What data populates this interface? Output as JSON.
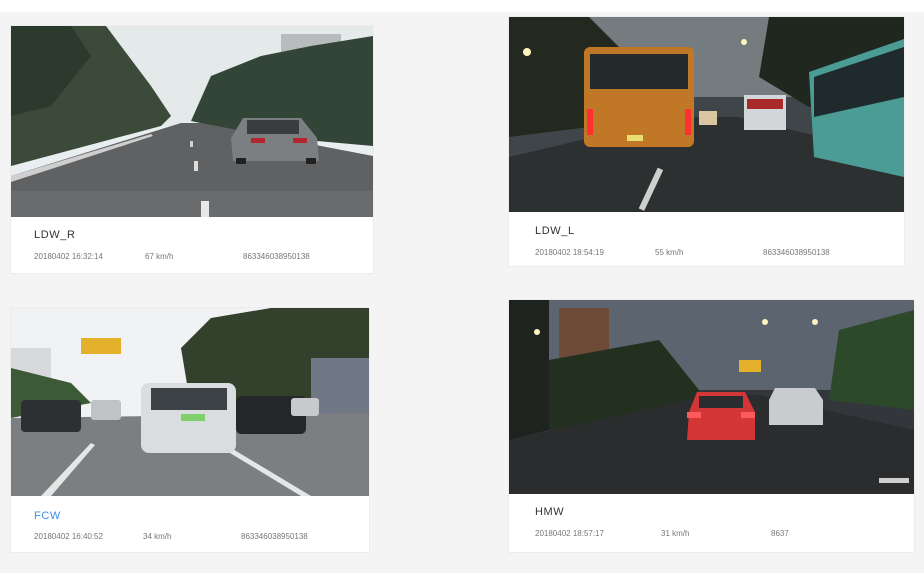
{
  "events": [
    {
      "type": "LDW_R",
      "datetime": "20180402 16:32:14",
      "speed": "67 km/h",
      "device_id": "863346038950138"
    },
    {
      "type": "LDW_L",
      "datetime": "20180402 18:54:19",
      "speed": "55 km/h",
      "device_id": "863346038950138"
    },
    {
      "type": "FCW",
      "datetime": "20180402 16:40:52",
      "speed": "34 km/h",
      "device_id": "863346038950138"
    },
    {
      "type": "HMW",
      "datetime": "20180402 18:57:17",
      "speed": "31 km/h",
      "device_id": "8637"
    }
  ],
  "colors": {
    "link": "#3a8ee6",
    "text": "#333333",
    "meta": "#777777"
  }
}
